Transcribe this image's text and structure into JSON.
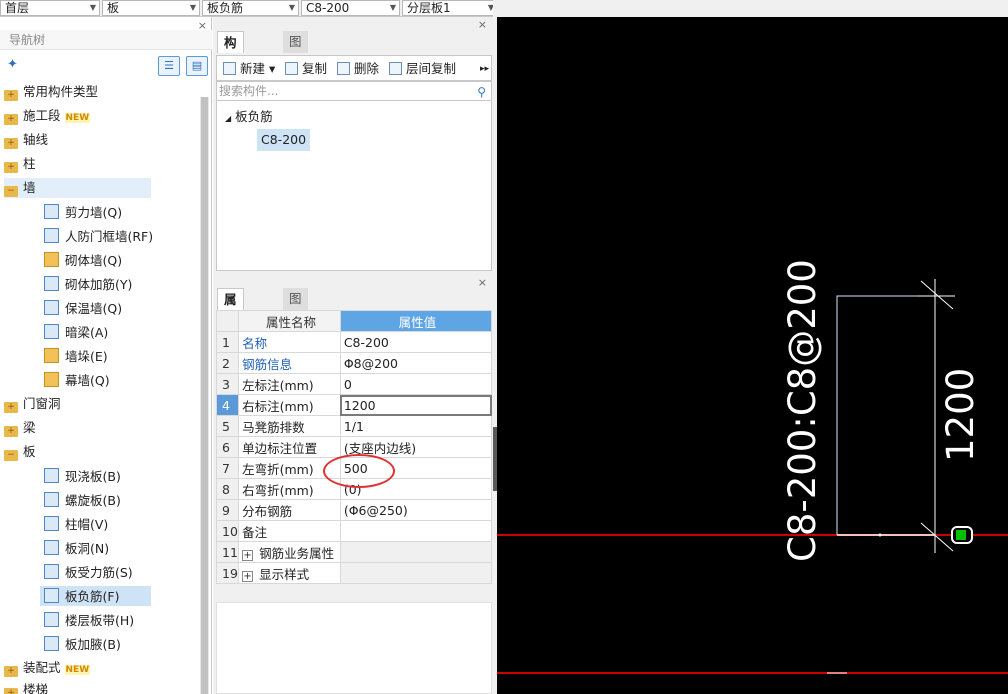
{
  "topbar": {
    "floor": "首层",
    "category": "板",
    "type": "板负筋",
    "component": "C8-200",
    "layer": "分层板1"
  },
  "nav": {
    "title": "导航树",
    "items": [
      {
        "label": "常用构件类型"
      },
      {
        "label": "施工段",
        "badge": "NEW"
      },
      {
        "label": "轴线"
      },
      {
        "label": "柱"
      },
      {
        "label": "墙"
      },
      {
        "label": "剪力墙(Q)"
      },
      {
        "label": "人防门框墙(RF)"
      },
      {
        "label": "砌体墙(Q)"
      },
      {
        "label": "砌体加筋(Y)"
      },
      {
        "label": "保温墙(Q)"
      },
      {
        "label": "暗梁(A)"
      },
      {
        "label": "墙垛(E)"
      },
      {
        "label": "幕墙(Q)"
      },
      {
        "label": "门窗洞"
      },
      {
        "label": "梁"
      },
      {
        "label": "板"
      },
      {
        "label": "现浇板(B)"
      },
      {
        "label": "螺旋板(B)"
      },
      {
        "label": "柱帽(V)"
      },
      {
        "label": "板洞(N)"
      },
      {
        "label": "板受力筋(S)"
      },
      {
        "label": "板负筋(F)"
      },
      {
        "label": "楼层板带(H)"
      },
      {
        "label": "板加腋(B)"
      },
      {
        "label": "装配式",
        "badge": "NEW"
      },
      {
        "label": "楼梯"
      }
    ]
  },
  "component_panel": {
    "tabs": [
      "构件列表",
      "图纸管理"
    ],
    "toolbar": {
      "new": "新建",
      "copy": "复制",
      "delete": "删除",
      "floor_copy": "层间复制"
    },
    "search_placeholder": "搜索构件...",
    "tree_root": "板负筋",
    "tree_item": "C8-200"
  },
  "property_panel": {
    "tabs": [
      "属性列表",
      "图层管理"
    ],
    "col_name": "属性名称",
    "col_value": "属性值",
    "rows": [
      {
        "no": "1",
        "name": "名称",
        "value": "C8-200"
      },
      {
        "no": "2",
        "name": "钢筋信息",
        "value": "Φ8@200"
      },
      {
        "no": "3",
        "name": "左标注(mm)",
        "value": "0"
      },
      {
        "no": "4",
        "name": "右标注(mm)",
        "value": "1200"
      },
      {
        "no": "5",
        "name": "马凳筋排数",
        "value": "1/1"
      },
      {
        "no": "6",
        "name": "单边标注位置",
        "value": "(支座内边线)"
      },
      {
        "no": "7",
        "name": "左弯折(mm)",
        "value": "500"
      },
      {
        "no": "8",
        "name": "右弯折(mm)",
        "value": "(0)"
      },
      {
        "no": "9",
        "name": "分布钢筋",
        "value": "(Φ6@250)"
      },
      {
        "no": "10",
        "name": "备注",
        "value": ""
      },
      {
        "no": "11",
        "name": "钢筋业务属性",
        "value": ""
      },
      {
        "no": "19",
        "name": "显示样式",
        "value": ""
      }
    ]
  },
  "cad": {
    "label_main": "C8-200:C8@200",
    "label_dim": "1200",
    "colors": {
      "background": "#000000",
      "line_red": "#cc0000",
      "text": "#ffffff",
      "marker": "#00c000"
    }
  }
}
